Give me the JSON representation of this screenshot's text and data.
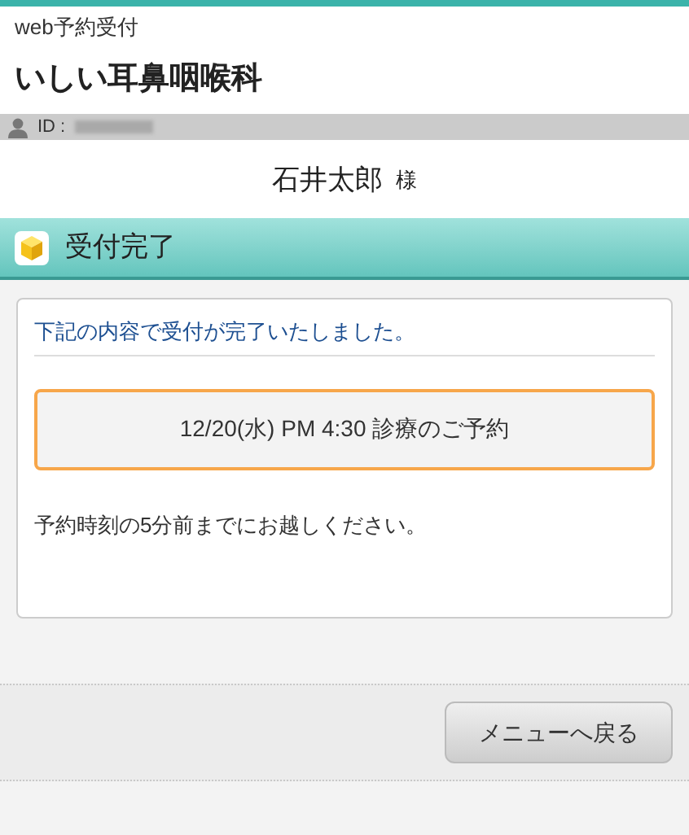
{
  "header": {
    "subtitle": "web予約受付",
    "clinic_name": "いしい耳鼻咽喉科"
  },
  "user_bar": {
    "id_label": "ID :"
  },
  "patient": {
    "name": "石井太郎",
    "honorific": "様"
  },
  "section": {
    "title": "受付完了"
  },
  "card": {
    "message": "下記の内容で受付が完了いたしました。",
    "reservation": "12/20(水) PM 4:30 診療のご予約",
    "note": "予約時刻の5分前までにお越しください。"
  },
  "footer": {
    "buttons": [
      "メニューへ戻る"
    ]
  }
}
